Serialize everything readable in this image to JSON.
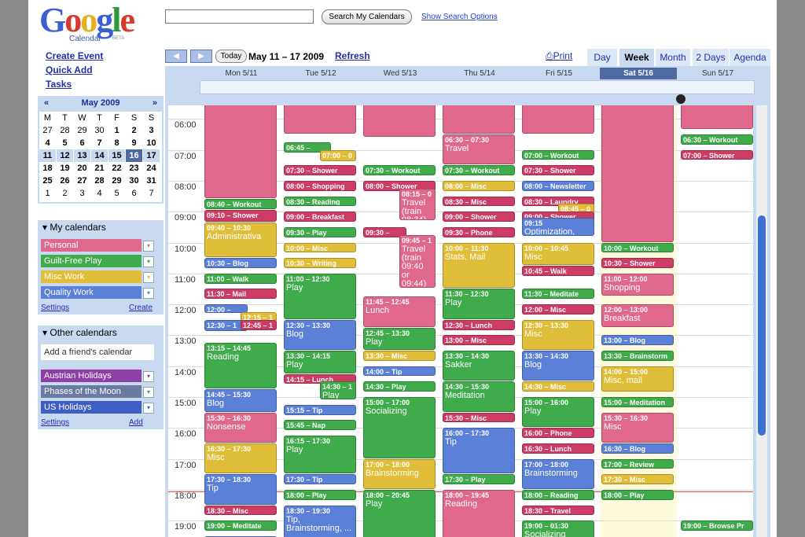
{
  "logo": {
    "word": "Google",
    "sub": "Calendar",
    "beta": "BETA"
  },
  "search": {
    "value": "",
    "button": "Search My Calendars",
    "options": "Show Search Options"
  },
  "sidebar": {
    "links": [
      "Create Event",
      "Quick Add",
      "Tasks"
    ]
  },
  "mini": {
    "title": "May 2009",
    "prev": "«",
    "next": "»",
    "weekdays": [
      "M",
      "T",
      "W",
      "T",
      "F",
      "S",
      "S"
    ],
    "rows": [
      [
        "27",
        "28",
        "29",
        "30",
        "1",
        "2",
        "3"
      ],
      [
        "4",
        "5",
        "6",
        "7",
        "8",
        "9",
        "10"
      ],
      [
        "11",
        "12",
        "13",
        "14",
        "15",
        "16",
        "17"
      ],
      [
        "18",
        "19",
        "20",
        "21",
        "22",
        "23",
        "24"
      ],
      [
        "25",
        "26",
        "27",
        "28",
        "29",
        "30",
        "31"
      ],
      [
        "1",
        "2",
        "3",
        "4",
        "5",
        "6",
        "7"
      ]
    ]
  },
  "my_calendars": {
    "title": "My calendars",
    "items": [
      {
        "label": "Personal",
        "color": "#e0688c"
      },
      {
        "label": "Guilt-Free Play",
        "color": "#3fab4a"
      },
      {
        "label": "Misc Work",
        "color": "#e1be3a"
      },
      {
        "label": "Quality Work",
        "color": "#5a80d8"
      }
    ],
    "settings": "Settings",
    "create": "Create"
  },
  "other_calendars": {
    "title": "Other calendars",
    "add_placeholder": "Add a friend's calendar",
    "items": [
      {
        "label": "Austrian Holidays",
        "color": "#8e3fa6"
      },
      {
        "label": "Phases of the Moon",
        "color": "#6a7aa0"
      },
      {
        "label": "US Holidays",
        "color": "#3d5fc4"
      }
    ],
    "settings": "Settings",
    "add": "Add"
  },
  "nav": {
    "today": "Today",
    "range": "May 11 – 17 2009",
    "refresh": "Refresh",
    "print": "Print"
  },
  "views": [
    "Day",
    "Week",
    "Month",
    "2 Days",
    "Agenda"
  ],
  "active_view": "Week",
  "days": [
    "Mon 5/11",
    "Tue 5/12",
    "Wed 5/13",
    "Thu 5/14",
    "Fri 5/15",
    "Sat 5/16",
    "Sun 5/17"
  ],
  "selected_day": "Sat 5/16",
  "hours": [
    "06:00",
    "07:00",
    "08:00",
    "09:00",
    "10:00",
    "11:00",
    "12:00",
    "13:00",
    "14:00",
    "15:00",
    "16:00",
    "17:00",
    "18:00",
    "19:00"
  ],
  "colors": {
    "P": "#e0688c",
    "G": "#3fab4a",
    "W": "#e1be3a",
    "Q": "#5a80d8",
    "B": "#cc3c64"
  },
  "events": [
    {
      "d": 0,
      "s": 5.0,
      "e": 8.6,
      "c": "P",
      "t": ""
    },
    {
      "d": 0,
      "s": 8.6,
      "e": 8.95,
      "c": "G",
      "t": "08:40 – Workout"
    },
    {
      "d": 0,
      "s": 8.95,
      "e": 9.35,
      "c": "B",
      "t": "09:10 – Shower"
    },
    {
      "d": 0,
      "s": 9.35,
      "e": 10.5,
      "c": "W",
      "t": "09:40 – 10:30",
      "n": "Administrativa"
    },
    {
      "d": 0,
      "s": 10.5,
      "e": 10.85,
      "c": "Q",
      "t": "10:30 – Blog"
    },
    {
      "d": 0,
      "s": 11.0,
      "e": 11.35,
      "c": "G",
      "t": "11:00 – Walk"
    },
    {
      "d": 0,
      "s": 11.5,
      "e": 11.85,
      "c": "B",
      "t": "11:30 – Mail"
    },
    {
      "d": 0,
      "s": 12.0,
      "e": 12.3,
      "c": "Q",
      "t": "12:00 – Brainst",
      "w": 0.6
    },
    {
      "d": 0,
      "s": 12.25,
      "e": 12.6,
      "c": "W",
      "t": "12:15 – 1",
      "o": 0.5,
      "w": 0.5
    },
    {
      "d": 0,
      "s": 12.5,
      "e": 12.9,
      "c": "Q",
      "t": "12:30 – 1",
      "w": 0.6
    },
    {
      "d": 0,
      "s": 12.5,
      "e": 12.85,
      "c": "B",
      "t": "12:45 – 1",
      "o": 0.5,
      "w": 0.5
    },
    {
      "d": 0,
      "s": 13.25,
      "e": 14.75,
      "c": "G",
      "t": "13:15 – 14:45",
      "n": "Reading"
    },
    {
      "d": 0,
      "s": 14.75,
      "e": 15.5,
      "c": "Q",
      "t": "14:45 – 15:30",
      "n": "Blog"
    },
    {
      "d": 0,
      "s": 15.5,
      "e": 16.5,
      "c": "P",
      "t": "15:30 – 16:30",
      "n": "Nonsense"
    },
    {
      "d": 0,
      "s": 16.5,
      "e": 17.5,
      "c": "W",
      "t": "16:30 – 17:30",
      "n": "Misc"
    },
    {
      "d": 0,
      "s": 17.5,
      "e": 18.5,
      "c": "Q",
      "t": "17:30 – 18:30",
      "n": "Tip"
    },
    {
      "d": 0,
      "s": 18.5,
      "e": 18.85,
      "c": "B",
      "t": "18:30 – Misc"
    },
    {
      "d": 0,
      "s": 19.0,
      "e": 19.35,
      "c": "G",
      "t": "19:00 – Meditate"
    },
    {
      "d": 0,
      "s": 19.5,
      "e": 19.8,
      "c": "Q",
      "t": "19:30 – Blog"
    },
    {
      "d": 1,
      "s": 5.0,
      "e": 6.5,
      "c": "P",
      "t": ""
    },
    {
      "d": 1,
      "s": 6.75,
      "e": 7.1,
      "c": "G",
      "t": "06:45 – Workout",
      "w": 0.65
    },
    {
      "d": 1,
      "s": 7.0,
      "e": 7.4,
      "c": "W",
      "t": "07:00 – 0",
      "o": 0.5,
      "w": 0.5
    },
    {
      "d": 1,
      "s": 7.5,
      "e": 7.85,
      "c": "B",
      "t": "07:30 – Shower"
    },
    {
      "d": 1,
      "s": 8.0,
      "e": 8.35,
      "c": "B",
      "t": "08:00 – Shopping"
    },
    {
      "d": 1,
      "s": 8.5,
      "e": 8.85,
      "c": "G",
      "t": "08:30 – Reading"
    },
    {
      "d": 1,
      "s": 9.0,
      "e": 9.35,
      "c": "B",
      "t": "09:00 – Breakfast"
    },
    {
      "d": 1,
      "s": 9.5,
      "e": 9.85,
      "c": "G",
      "t": "09:30 – Play"
    },
    {
      "d": 1,
      "s": 10.0,
      "e": 10.35,
      "c": "W",
      "t": "10:00 – Misc"
    },
    {
      "d": 1,
      "s": 10.5,
      "e": 10.85,
      "c": "W",
      "t": "10:30 – Writing"
    },
    {
      "d": 1,
      "s": 11.0,
      "e": 12.5,
      "c": "G",
      "t": "11:00 – 12:30",
      "n": "Play"
    },
    {
      "d": 1,
      "s": 12.5,
      "e": 13.5,
      "c": "Q",
      "t": "12:30 – 13:30",
      "n": "Blog"
    },
    {
      "d": 1,
      "s": 13.5,
      "e": 14.25,
      "c": "G",
      "t": "13:30 – 14:15",
      "n": "Play"
    },
    {
      "d": 1,
      "s": 14.25,
      "e": 14.6,
      "c": "B",
      "t": "14:15 – Lunch"
    },
    {
      "d": 1,
      "s": 14.5,
      "e": 15.1,
      "c": "G",
      "t": "14:30 – 1",
      "o": 0.5,
      "w": 0.5,
      "n": "Play"
    },
    {
      "d": 1,
      "s": 15.25,
      "e": 15.6,
      "c": "Q",
      "t": "15:15 – Tip"
    },
    {
      "d": 1,
      "s": 15.75,
      "e": 16.1,
      "c": "G",
      "t": "15:45 – Nap"
    },
    {
      "d": 1,
      "s": 16.25,
      "e": 17.5,
      "c": "G",
      "t": "16:15 – 17:30",
      "n": "Play"
    },
    {
      "d": 1,
      "s": 17.5,
      "e": 17.85,
      "c": "Q",
      "t": "17:30 – Tip"
    },
    {
      "d": 1,
      "s": 18.0,
      "e": 18.35,
      "c": "G",
      "t": "18:00 – Play"
    },
    {
      "d": 1,
      "s": 18.5,
      "e": 19.6,
      "c": "Q",
      "t": "18:30 – 19:30",
      "n": "Tip, Brainstorming, ..."
    },
    {
      "d": 1,
      "s": 19.6,
      "e": 19.9,
      "c": "G",
      "t": "19:30 – 20:00"
    },
    {
      "d": 2,
      "s": 5.0,
      "e": 6.6,
      "c": "P",
      "t": ""
    },
    {
      "d": 2,
      "s": 7.5,
      "e": 7.85,
      "c": "G",
      "t": "07:30 – Workout"
    },
    {
      "d": 2,
      "s": 8.0,
      "e": 8.35,
      "c": "B",
      "t": "08:00 – Shower"
    },
    {
      "d": 2,
      "s": 8.25,
      "e": 9.3,
      "c": "P",
      "t": "08:15 – 0",
      "o": 0.5,
      "w": 0.5,
      "n": "Travel (train 08:34)"
    },
    {
      "d": 2,
      "s": 9.5,
      "e": 9.85,
      "c": "B",
      "t": "09:30 – Vienna",
      "w": 0.6
    },
    {
      "d": 2,
      "s": 9.75,
      "e": 11.5,
      "c": "P",
      "t": "09:45 – 1",
      "o": 0.5,
      "w": 0.5,
      "n": "Travel (train 09:40 or 09:44)"
    },
    {
      "d": 2,
      "s": 11.75,
      "e": 12.75,
      "c": "P",
      "t": "11:45 – 12:45",
      "n": "Lunch"
    },
    {
      "d": 2,
      "s": 12.75,
      "e": 13.5,
      "c": "G",
      "t": "12:45 – 13:30",
      "n": "Play"
    },
    {
      "d": 2,
      "s": 13.5,
      "e": 13.85,
      "c": "W",
      "t": "13:30 – Misc"
    },
    {
      "d": 2,
      "s": 14.0,
      "e": 14.35,
      "c": "Q",
      "t": "14:00 – Tip"
    },
    {
      "d": 2,
      "s": 14.5,
      "e": 14.85,
      "c": "G",
      "t": "14:30 – Play"
    },
    {
      "d": 2,
      "s": 15.0,
      "e": 17.0,
      "c": "G",
      "t": "15:00 – 17:00",
      "n": "Socializing"
    },
    {
      "d": 2,
      "s": 17.0,
      "e": 18.0,
      "c": "W",
      "t": "17:00 – 18:00",
      "n": "Brainstorming"
    },
    {
      "d": 2,
      "s": 18.0,
      "e": 19.9,
      "c": "G",
      "t": "18:00 – 20:45",
      "n": "Play"
    },
    {
      "d": 3,
      "s": 5.0,
      "e": 6.5,
      "c": "P",
      "t": ""
    },
    {
      "d": 3,
      "s": 6.5,
      "e": 7.5,
      "c": "P",
      "t": "06:30 – 07:30",
      "n": "Travel"
    },
    {
      "d": 3,
      "s": 7.5,
      "e": 7.85,
      "c": "G",
      "t": "07:30 – Workout"
    },
    {
      "d": 3,
      "s": 8.0,
      "e": 8.35,
      "c": "W",
      "t": "08:00 – Misc"
    },
    {
      "d": 3,
      "s": 8.5,
      "e": 8.85,
      "c": "B",
      "t": "08:30 – Misc"
    },
    {
      "d": 3,
      "s": 9.0,
      "e": 9.35,
      "c": "B",
      "t": "09:00 – Shower"
    },
    {
      "d": 3,
      "s": 9.5,
      "e": 9.85,
      "c": "B",
      "t": "09:30 – Phone"
    },
    {
      "d": 3,
      "s": 10.0,
      "e": 11.5,
      "c": "W",
      "t": "10:00 – 11:30",
      "n": "Stats, Mail"
    },
    {
      "d": 3,
      "s": 11.5,
      "e": 12.5,
      "c": "G",
      "t": "11:30 – 12:30",
      "n": "Play"
    },
    {
      "d": 3,
      "s": 12.5,
      "e": 12.85,
      "c": "B",
      "t": "12:30 – Lunch"
    },
    {
      "d": 3,
      "s": 13.0,
      "e": 13.35,
      "c": "B",
      "t": "13:00 – Misc"
    },
    {
      "d": 3,
      "s": 13.5,
      "e": 14.5,
      "c": "G",
      "t": "13:30 – 14:30",
      "n": "Sakker"
    },
    {
      "d": 3,
      "s": 14.5,
      "e": 15.5,
      "c": "G",
      "t": "14:30 – 15:30",
      "n": "Meditation"
    },
    {
      "d": 3,
      "s": 15.5,
      "e": 15.85,
      "c": "B",
      "t": "15:30 – Misc"
    },
    {
      "d": 3,
      "s": 16.0,
      "e": 17.5,
      "c": "Q",
      "t": "16:00 – 17:30",
      "n": "Tip"
    },
    {
      "d": 3,
      "s": 17.5,
      "e": 17.85,
      "c": "G",
      "t": "17:30 – Play"
    },
    {
      "d": 3,
      "s": 18.0,
      "e": 19.9,
      "c": "P",
      "t": "18:00 – 19:45",
      "n": "Reading"
    },
    {
      "d": 4,
      "s": 5.0,
      "e": 6.5,
      "c": "P",
      "t": ""
    },
    {
      "d": 4,
      "s": 7.0,
      "e": 7.35,
      "c": "G",
      "t": "07:00 – Workout"
    },
    {
      "d": 4,
      "s": 7.5,
      "e": 7.85,
      "c": "B",
      "t": "07:30 – Shower"
    },
    {
      "d": 4,
      "s": 8.0,
      "e": 8.35,
      "c": "Q",
      "t": "08:00 – Newsletter"
    },
    {
      "d": 4,
      "s": 8.5,
      "e": 8.85,
      "c": "B",
      "t": "08:30 – Laundry"
    },
    {
      "d": 4,
      "s": 8.75,
      "e": 9.1,
      "c": "W",
      "t": "08:45 – 0",
      "o": 0.5,
      "w": 0.5
    },
    {
      "d": 4,
      "s": 9.0,
      "e": 9.35,
      "c": "B",
      "t": "09:00 – Shower"
    },
    {
      "d": 4,
      "s": 9.2,
      "e": 9.8,
      "c": "Q",
      "t": "09:15",
      "n": "Optimization, misc"
    },
    {
      "d": 4,
      "s": 10.0,
      "e": 10.75,
      "c": "W",
      "t": "10:00 – 10:45",
      "n": "Misc"
    },
    {
      "d": 4,
      "s": 10.75,
      "e": 11.1,
      "c": "B",
      "t": "10:45 – Walk"
    },
    {
      "d": 4,
      "s": 11.5,
      "e": 11.85,
      "c": "G",
      "t": "11:30 – Meditate"
    },
    {
      "d": 4,
      "s": 12.0,
      "e": 12.35,
      "c": "B",
      "t": "12:00 – Misc"
    },
    {
      "d": 4,
      "s": 12.5,
      "e": 13.5,
      "c": "W",
      "t": "12:30 – 13:30",
      "n": "Misc"
    },
    {
      "d": 4,
      "s": 13.5,
      "e": 14.5,
      "c": "Q",
      "t": "13:30 – 14:30",
      "n": "Blog"
    },
    {
      "d": 4,
      "s": 14.5,
      "e": 14.85,
      "c": "W",
      "t": "14:30 – Misc"
    },
    {
      "d": 4,
      "s": 15.0,
      "e": 16.0,
      "c": "G",
      "t": "15:00 – 16:00",
      "n": "Play"
    },
    {
      "d": 4,
      "s": 16.0,
      "e": 16.35,
      "c": "B",
      "t": "16:00 – Phone"
    },
    {
      "d": 4,
      "s": 16.5,
      "e": 16.85,
      "c": "B",
      "t": "16:30 – Lunch"
    },
    {
      "d": 4,
      "s": 17.0,
      "e": 18.0,
      "c": "Q",
      "t": "17:00 – 18:00",
      "n": "Brainstorming"
    },
    {
      "d": 4,
      "s": 18.0,
      "e": 18.35,
      "c": "G",
      "t": "18:00 – Reading"
    },
    {
      "d": 4,
      "s": 18.5,
      "e": 18.85,
      "c": "B",
      "t": "18:30 – Travel"
    },
    {
      "d": 4,
      "s": 19.0,
      "e": 19.9,
      "c": "G",
      "t": "19:00 – 01:30",
      "n": "Socializing"
    },
    {
      "d": 5,
      "s": 5.0,
      "e": 10.0,
      "c": "P",
      "t": ""
    },
    {
      "d": 5,
      "s": 10.0,
      "e": 10.35,
      "c": "G",
      "t": "10:00 – Workout"
    },
    {
      "d": 5,
      "s": 10.5,
      "e": 10.85,
      "c": "B",
      "t": "10:30 – Shower"
    },
    {
      "d": 5,
      "s": 11.0,
      "e": 11.75,
      "c": "P",
      "t": "11:00 – 12:00",
      "n": "Shopping"
    },
    {
      "d": 5,
      "s": 12.0,
      "e": 12.75,
      "c": "P",
      "t": "12:00 – 13:00",
      "n": "Breakfast"
    },
    {
      "d": 5,
      "s": 13.0,
      "e": 13.35,
      "c": "Q",
      "t": "13:00 – Blog"
    },
    {
      "d": 5,
      "s": 13.5,
      "e": 13.85,
      "c": "G",
      "t": "13:30 – Brainstorm"
    },
    {
      "d": 5,
      "s": 14.0,
      "e": 14.85,
      "c": "W",
      "t": "14:00 – 15:00",
      "n": "Misc, mail"
    },
    {
      "d": 5,
      "s": 15.0,
      "e": 15.35,
      "c": "G",
      "t": "15:00 – Meditation"
    },
    {
      "d": 5,
      "s": 15.5,
      "e": 16.5,
      "c": "P",
      "t": "15:30 – 16:30",
      "n": "Misc"
    },
    {
      "d": 5,
      "s": 16.5,
      "e": 16.85,
      "c": "Q",
      "t": "16:30 – Blog"
    },
    {
      "d": 5,
      "s": 17.0,
      "e": 17.35,
      "c": "G",
      "t": "17:00 – Review"
    },
    {
      "d": 5,
      "s": 17.5,
      "e": 17.85,
      "c": "W",
      "t": "17:30 – Misc"
    },
    {
      "d": 5,
      "s": 18.0,
      "e": 18.35,
      "c": "G",
      "t": "18:00 – Play"
    },
    {
      "d": 6,
      "s": 5.0,
      "e": 6.35,
      "c": "P",
      "t": ""
    },
    {
      "d": 6,
      "s": 6.5,
      "e": 6.85,
      "c": "G",
      "t": "06:30 – Workout"
    },
    {
      "d": 6,
      "s": 7.0,
      "e": 7.35,
      "c": "B",
      "t": "07:00 – Shower"
    },
    {
      "d": 6,
      "s": 19.0,
      "e": 19.35,
      "c": "G",
      "t": "19:00 – Browse Pr"
    }
  ]
}
